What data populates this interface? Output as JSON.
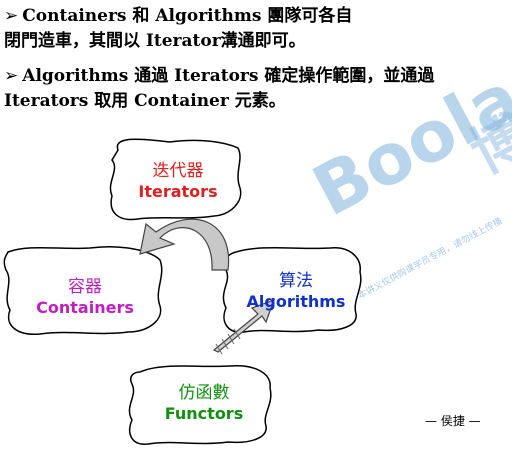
{
  "bullets": [
    {
      "line1": "Containers 和 Algorithms 團隊可各自",
      "line2": "閉門造車，其間以 Iterator溝通即可。"
    },
    {
      "line1": "Algorithms 通過 Iterators 確定操作範圍，並通過",
      "line2": "Iterators 取用 Container 元素。"
    }
  ],
  "bullet_marker": "➢",
  "boxes": {
    "iterators": {
      "zh": "迭代器",
      "en": "Iterators",
      "color": "#e02020"
    },
    "containers": {
      "zh": "容器",
      "en": "Containers",
      "color": "#c020c0"
    },
    "algorithms": {
      "zh": "算法",
      "en": "Algorithms",
      "color": "#1030d0"
    },
    "functors": {
      "zh": "仿函數",
      "en": "Functors",
      "color": "#109010"
    }
  },
  "watermark": {
    "brand": "Boolan",
    "char": "博",
    "notice": "本讲义仅供购课学员专用，请勿线上传播"
  },
  "author": "— 侯捷 —"
}
